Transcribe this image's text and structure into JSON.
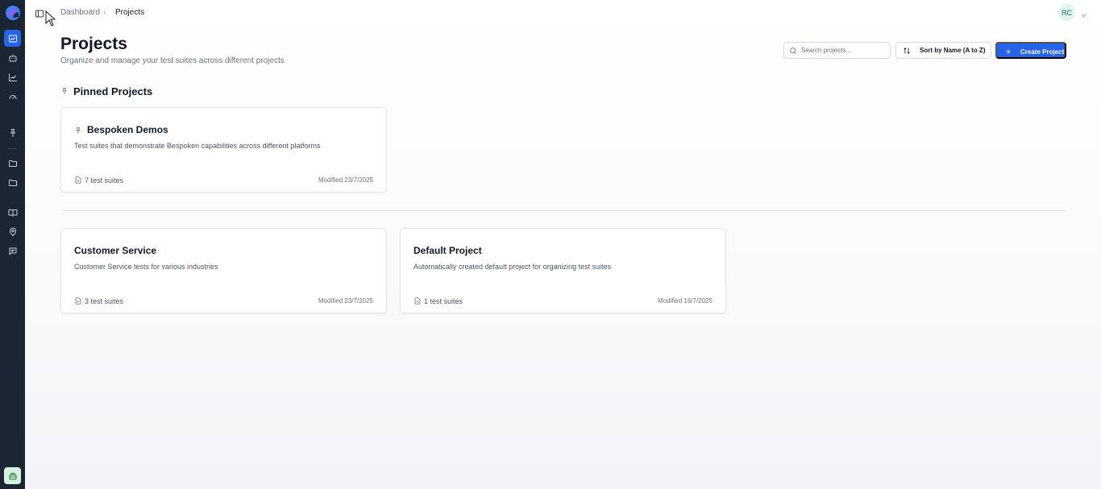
{
  "breadcrumb": {
    "root": "Dashboard",
    "separator": "›",
    "current": "Projects"
  },
  "user": {
    "initials": "RC"
  },
  "page": {
    "title": "Projects",
    "subtitle": "Organize and manage your test suites across different projects"
  },
  "toolbar": {
    "search_placeholder": "Search projects...",
    "sort_label": "Sort by Name (A to Z)",
    "create_label": "Create Project"
  },
  "pinned": {
    "heading": "Pinned Projects",
    "projects": [
      {
        "name": "Bespoken Demos",
        "description": "Test suites that demonstrate Bespoken capabilities across different platforms",
        "suites": "7 test suites",
        "modified": "Modified 23/7/2025"
      }
    ]
  },
  "projects": [
    {
      "name": "Customer Service",
      "description": "Customer Service tests for various industries",
      "suites": "3 test suites",
      "modified": "Modified 23/7/2025"
    },
    {
      "name": "Default Project",
      "description": "Automatically created default project for organizing test suites",
      "suites": "1 test suites",
      "modified": "Modified 16/7/2025"
    }
  ],
  "colors": {
    "rail": "#1b2534",
    "accent": "#2563eb",
    "avatar_bg": "#dff5ee"
  },
  "icons": {
    "rail": [
      "dashboard-icon",
      "bot-icon",
      "chart-line-icon",
      "gauge-icon",
      "pin-icon",
      "folder-icon",
      "folder-icon",
      "book-icon",
      "map-pin-icon",
      "message-icon",
      "package-icon"
    ]
  }
}
